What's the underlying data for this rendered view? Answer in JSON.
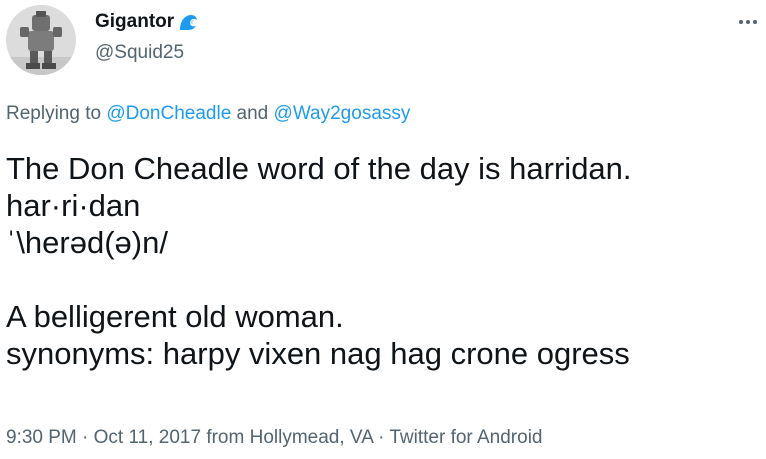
{
  "author": {
    "display_name": "Gigantor",
    "handle": "@Squid25",
    "badge_icon": "water-wave-icon",
    "avatar_icon": "robot-avatar"
  },
  "reply": {
    "prefix": "Replying to ",
    "mention_1": "@DonCheadle",
    "connector": " and ",
    "mention_2": "@Way2gosassy"
  },
  "tweet": {
    "line_1": "The Don Cheadle word of the day is harridan.",
    "line_2": "har·ri·dan",
    "line_3": "ˈ\\herəd(ə)n/",
    "line_4": "",
    "line_5": "A belligerent old woman.",
    "line_6": "synonyms: harpy vixen nag hag crone ogress"
  },
  "meta": {
    "time": "9:30 PM",
    "sep_1": " · ",
    "date": "Oct 11, 2017",
    "from": " from ",
    "location": "Hollymead, VA",
    "sep_2": " · ",
    "source": "Twitter for Android"
  },
  "colors": {
    "text": "#0f1419",
    "secondary": "#536471",
    "accent": "#1d9bf0"
  }
}
